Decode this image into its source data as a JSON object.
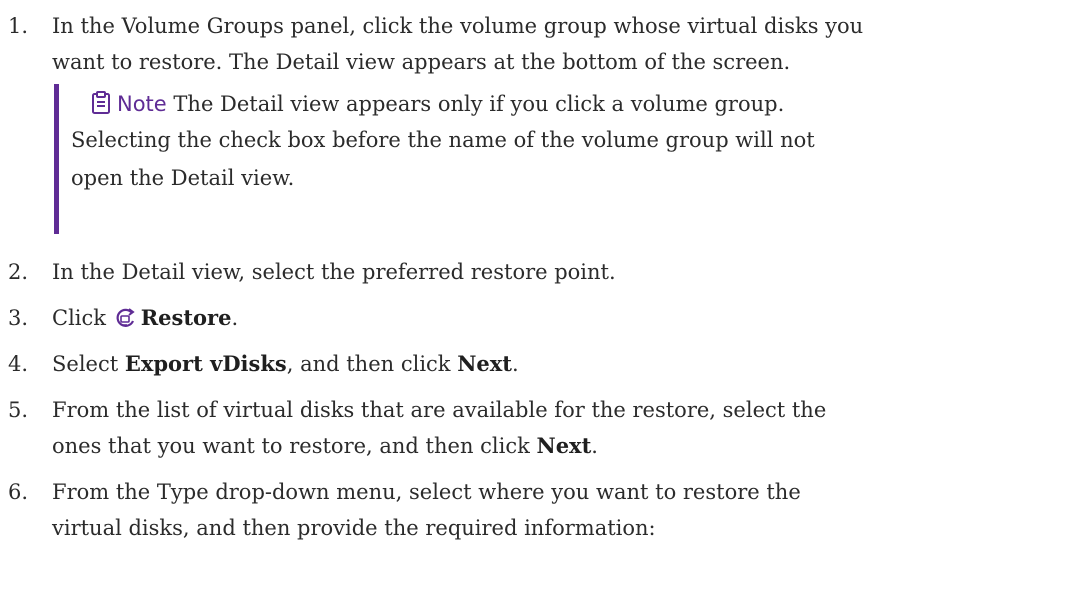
{
  "steps": [
    {
      "num": "1.",
      "lines": [
        "In the Volume Groups panel, click the volume group whose virtual disks you",
        "want to restore. The Detail view appears at the bottom of the screen."
      ]
    },
    {
      "num": "2.",
      "text": "In the Detail view, select the preferred restore point."
    },
    {
      "num": "3.",
      "pre": "Click",
      "bold": "Restore",
      "post": "."
    },
    {
      "num": "4.",
      "pre": "Select ",
      "bold1": "Export vDisks",
      "mid": ", and then click ",
      "bold2": "Next",
      "post": "."
    },
    {
      "num": "5.",
      "line1": "From the list of virtual disks that are available for the restore, select the",
      "pre2": "ones that you want to restore, and then click ",
      "bold": "Next",
      "post": "."
    },
    {
      "num": "6.",
      "lines": [
        "From the Type drop-down menu, select where you want to restore the",
        "virtual disks, and then provide the required information:"
      ]
    }
  ],
  "note": {
    "icon": "clipboard-note-icon",
    "label": "Note",
    "lines": [
      "The Detail view appears only if you click a volume group.",
      "Selecting the check box before the name of the volume group will not",
      "open the Detail view."
    ]
  },
  "icons": {
    "restore": "restore-icon"
  },
  "colors": {
    "accent": "#5f2c95",
    "text": "#2b2b2b"
  }
}
